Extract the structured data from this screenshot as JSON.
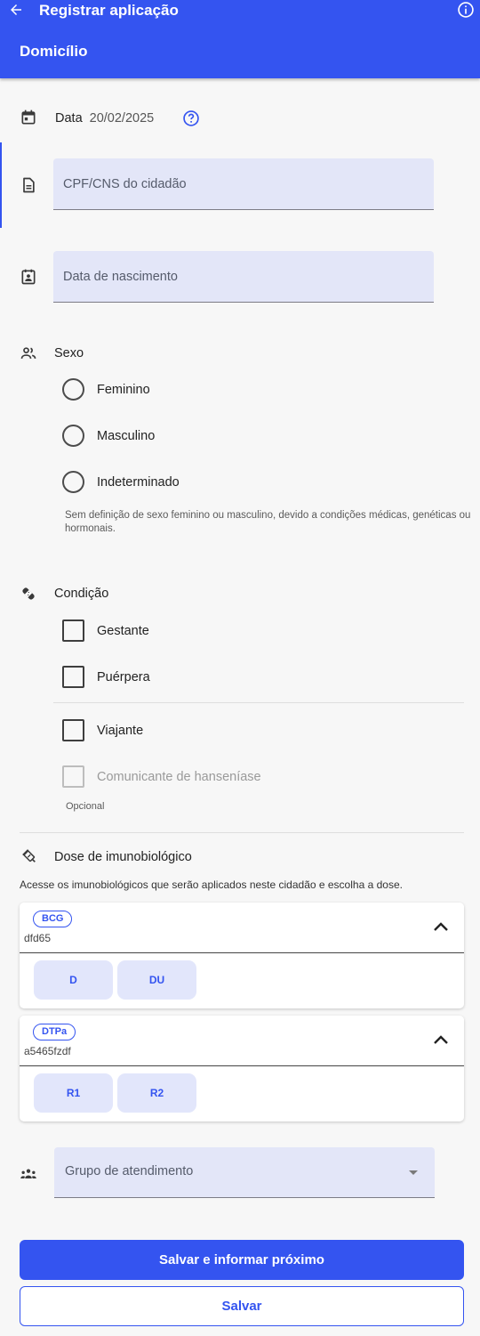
{
  "header": {
    "title": "Registrar aplicação",
    "subtitle": "Domicílio"
  },
  "date": {
    "label": "Data",
    "value": "20/02/2025"
  },
  "fields": {
    "cpf_placeholder": "CPF/CNS do cidadão",
    "birth_placeholder": "Data de nascimento"
  },
  "sexo": {
    "label": "Sexo",
    "options": [
      "Feminino",
      "Masculino",
      "Indeterminado"
    ],
    "hint": "Sem definição de sexo feminino ou masculino, devido a condições médicas, genéticas ou hormonais."
  },
  "condicao": {
    "label": "Condição",
    "options": [
      "Gestante",
      "Puérpera",
      "Viajante",
      "Comunicante de hanseníase"
    ],
    "optional": "Opcional"
  },
  "imunobiologico": {
    "label": "Dose de imunobiológico",
    "description": "Acesse os imunobiológicos que serão aplicados neste cidadão e escolha a dose.",
    "items": [
      {
        "name": "BCG",
        "lot": "dfd65",
        "doses": [
          "D",
          "DU"
        ]
      },
      {
        "name": "DTPa",
        "lot": "a5465fzdf",
        "doses": [
          "R1",
          "R2"
        ]
      }
    ]
  },
  "grupo": {
    "placeholder": "Grupo de atendimento"
  },
  "actions": {
    "save_next": "Salvar e informar próximo",
    "save": "Salvar"
  },
  "colors": {
    "primary": "#3454f0",
    "field_bg": "#e3e6f8"
  },
  "icons": {
    "back": "arrow-left-icon",
    "info": "info-icon",
    "calendar": "calendar-icon",
    "help": "help-circle-icon",
    "document": "document-icon",
    "birth": "calendar-user-icon",
    "people": "people-icon",
    "condition": "bandage-icon",
    "vaccine": "syringe-icon",
    "group": "group-icon"
  }
}
